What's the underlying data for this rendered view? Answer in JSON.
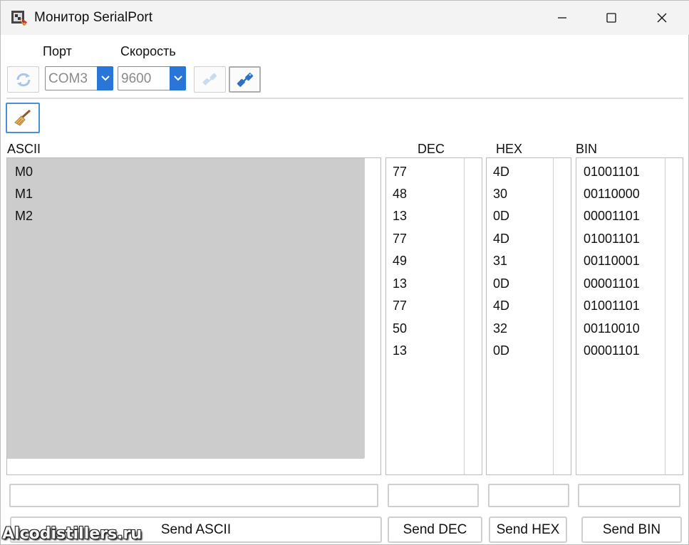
{
  "window": {
    "title": "Монитор SerialPort",
    "minimize": "—",
    "maximize": "☐",
    "close": "✕"
  },
  "toolbar": {
    "port_label": "Порт",
    "port_value": "COM3",
    "speed_label": "Скорость",
    "speed_value": "9600",
    "refresh_icon": "refresh-icon",
    "disconnect_icon": "disconnect-icon",
    "connect_icon": "connect-icon",
    "clear_icon": "broom-icon"
  },
  "columns": {
    "ascii_header": "ASCII",
    "dec_header": "DEC",
    "hex_header": "HEX",
    "bin_header": "BIN"
  },
  "ascii_rows": [
    "M0",
    "M1",
    "M2"
  ],
  "dec_rows": [
    "77",
    "48",
    "13",
    "77",
    "49",
    "13",
    "77",
    "50",
    "13"
  ],
  "hex_rows": [
    "4D",
    "30",
    "0D",
    "4D",
    "31",
    "0D",
    "4D",
    "32",
    "0D"
  ],
  "bin_rows": [
    "01001101",
    "00110000",
    "00001101",
    "01001101",
    "00110001",
    "00001101",
    "01001101",
    "00110010",
    "00001101"
  ],
  "send_inputs": {
    "ascii": "",
    "dec": "",
    "hex": "",
    "bin": ""
  },
  "buttons": {
    "send_ascii": "Send ASCII",
    "send_dec": "Send DEC",
    "send_hex": "Send HEX",
    "send_bin": "Send BIN"
  },
  "watermark": "Alcodistillers.ru",
  "colors": {
    "accent": "#2a76d8",
    "ascii_bg": "#cccccc",
    "title_bg": "#f3f3f3"
  }
}
